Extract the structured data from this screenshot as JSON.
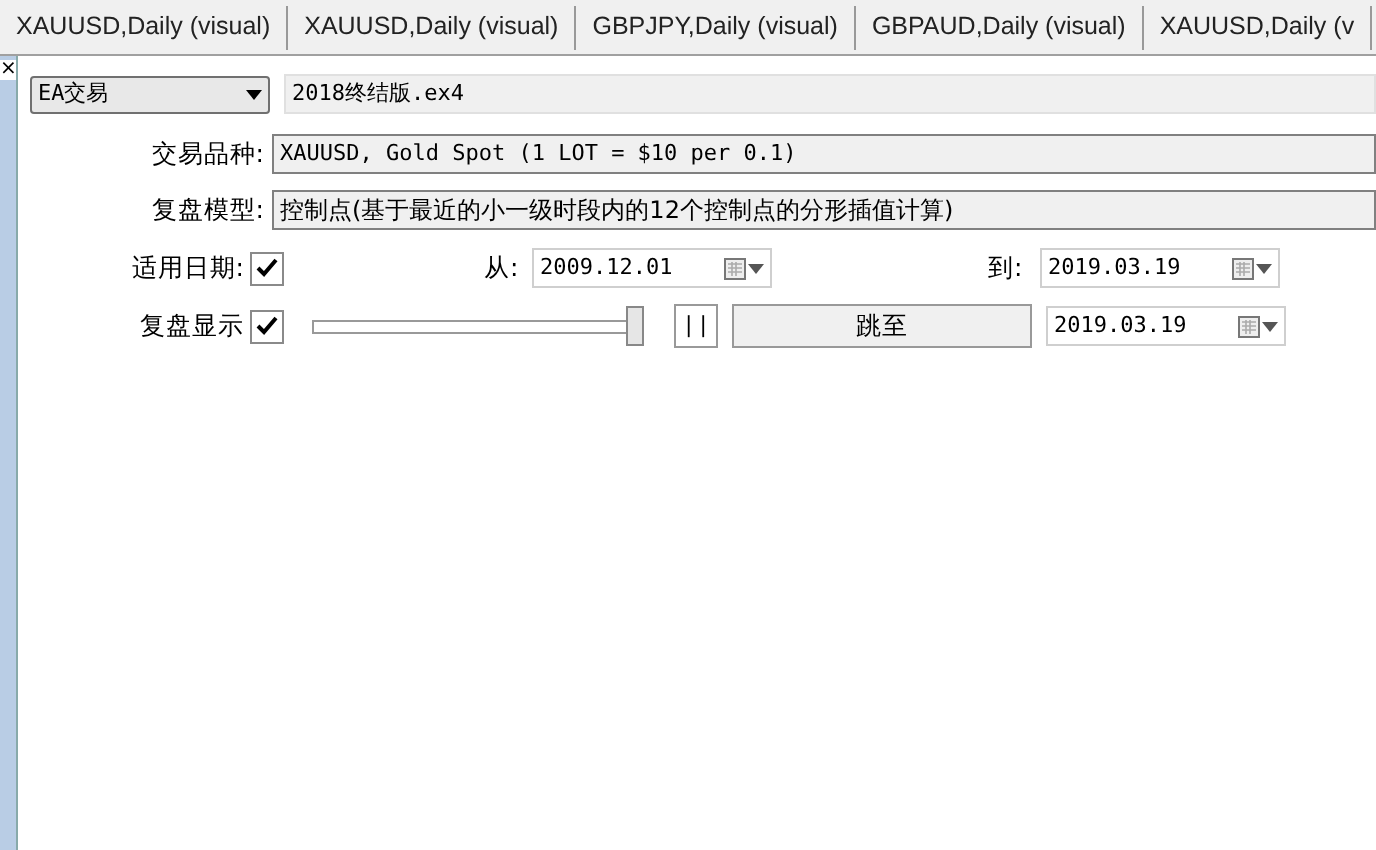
{
  "tabs": [
    {
      "label": "XAUUSD,Daily (visual)",
      "selected": false
    },
    {
      "label": "XAUUSD,Daily (visual)",
      "selected": false
    },
    {
      "label": "GBPJPY,Daily (visual)",
      "selected": false
    },
    {
      "label": "GBPAUD,Daily (visual)",
      "selected": false
    },
    {
      "label": "XAUUSD,Daily (v",
      "selected": false
    }
  ],
  "close_glyph": "×",
  "mode_dropdown": {
    "value": "EA交易"
  },
  "expert_file": {
    "value": "2018终结版.ex4"
  },
  "symbol": {
    "label": "交易品种:",
    "value": "XAUUSD, Gold Spot (1 LOT = $10 per 0.1)"
  },
  "model": {
    "label": "复盘模型:",
    "value": "控制点(基于最近的小一级时段内的12个控制点的分形插值计算)"
  },
  "use_date": {
    "label": "适用日期:",
    "checked": true,
    "from_label": "从:",
    "from": "2009.12.01",
    "to_label": "到:",
    "to": "2019.03.19"
  },
  "visual": {
    "label": "复盘显示",
    "checked": true,
    "speed": {
      "level": 1
    },
    "pause_button": "| |",
    "jump_button": "跳至",
    "jump_date": "2019.03.19"
  }
}
